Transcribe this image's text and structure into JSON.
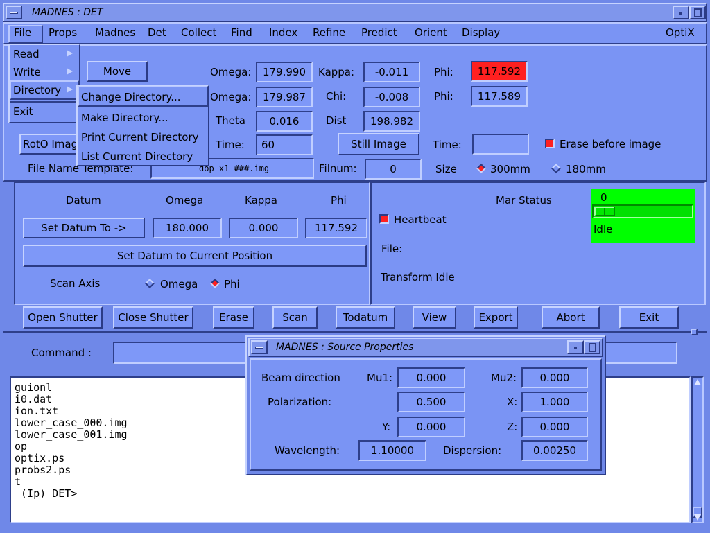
{
  "window": {
    "title": "MADNES : DET"
  },
  "menubar": {
    "items": [
      "File",
      "Props",
      "Madnes",
      "Det",
      "Collect",
      "Find",
      "Index",
      "Refine",
      "Predict",
      "Orient",
      "Display"
    ],
    "right": "OptiX"
  },
  "file_menu": {
    "items": [
      "Read",
      "Write",
      "Directory",
      "Exit"
    ]
  },
  "directory_submenu": {
    "items": [
      "Change Directory...",
      "Make Directory...",
      "Print Current Directory",
      "List Current Directory"
    ]
  },
  "goniometer": {
    "move_label": "Move",
    "omega_label": "Omega:",
    "omega_target": "179.990",
    "omega_current": "179.987",
    "kappa_label": "Kappa:",
    "kappa_target": "-0.011",
    "chi_label": "Chi:",
    "chi_current": "-0.008",
    "phi_label": "Phi:",
    "phi_target": "117.592",
    "phi_current": "117.589",
    "theta_label": "Theta",
    "theta_value": "0.016",
    "dist_label": "Dist",
    "dist_value": "198.982",
    "time_label": "Time:",
    "time_value": "60",
    "still_image_label": "Still Image",
    "time2_label": "Time:",
    "time2_value": "",
    "erase_before_label": "Erase before image",
    "roto_label": "RotO Image",
    "template_label": "File Name Template:",
    "template_value": "dop_x1_###.img",
    "filnum_label": "Filnum:",
    "filnum_value": "0",
    "size_label": "Size",
    "size_300": "300mm",
    "size_180": "180mm"
  },
  "datum": {
    "header": "Datum",
    "col_omega": "Omega",
    "col_kappa": "Kappa",
    "col_phi": "Phi",
    "set_datum_to_label": "Set Datum To ->",
    "omega": "180.000",
    "kappa": "0.000",
    "phi": "117.592",
    "set_current_label": "Set Datum to Current Position",
    "scan_axis_label": "Scan Axis",
    "scan_omega": "Omega",
    "scan_phi": "Phi"
  },
  "mar": {
    "title": "Mar Status",
    "heartbeat_label": "Heartbeat",
    "file_label": "File:",
    "transform_label": "Transform Idle",
    "progress_value": "0",
    "progress_fraction": 0,
    "state": "Idle",
    "status_color": "#00ff00"
  },
  "actions": [
    "Open Shutter",
    "Close Shutter",
    "Erase",
    "Scan",
    "Todatum",
    "View",
    "Export",
    "Abort",
    "Exit"
  ],
  "command": {
    "label": "Command :",
    "value": ""
  },
  "terminal": {
    "lines": [
      "guionl",
      "i0.dat",
      "ion.txt",
      "lower_case_000.img",
      "lower_case_001.img",
      "op",
      "optix.ps",
      "probs2.ps",
      "t",
      " (Ip) DET>"
    ]
  },
  "source_dialog": {
    "title": "MADNES : Source Properties",
    "beam_direction_label": "Beam direction",
    "mu1_label": "Mu1:",
    "mu1": "0.000",
    "mu2_label": "Mu2:",
    "mu2": "0.000",
    "polarization_label": "Polarization:",
    "polarization": "0.500",
    "x_label": "X:",
    "x": "1.000",
    "y_label": "Y:",
    "y": "0.000",
    "z_label": "Z:",
    "z": "0.000",
    "wavelength_label": "Wavelength:",
    "wavelength": "1.10000",
    "dispersion_label": "Dispersion:",
    "dispersion": "0.00250"
  },
  "colors": {
    "background": "#6f88e8",
    "alarm": "#ff2020",
    "status": "#00ff00"
  }
}
